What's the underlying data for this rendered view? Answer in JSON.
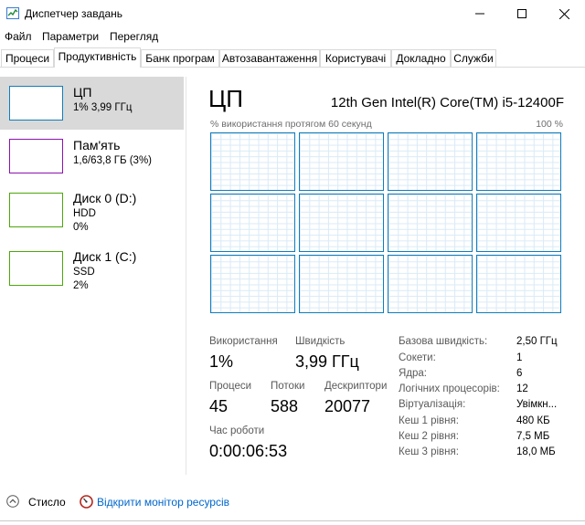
{
  "window": {
    "title": "Диспетчер завдань"
  },
  "menu": [
    "Файл",
    "Параметри",
    "Перегляд"
  ],
  "tabs": [
    "Процеси",
    "Продуктивність",
    "Банк програм",
    "Автозавантаження",
    "Користувачі",
    "Докладно",
    "Служби"
  ],
  "active_tab": "Продуктивність",
  "resources": [
    {
      "name": "ЦП",
      "sub1": "1% 3,99 ГГц",
      "sub2": "",
      "color": "#117dbb",
      "selected": true
    },
    {
      "name": "Пам'ять",
      "sub1": "1,6/63,8 ГБ (3%)",
      "sub2": "",
      "color": "#8b12ae"
    },
    {
      "name": "Диск 0 (D:)",
      "sub1": "HDD",
      "sub2": "0%",
      "color": "#4da60c"
    },
    {
      "name": "Диск 1 (C:)",
      "sub1": "SSD",
      "sub2": "2%",
      "color": "#4da60c"
    }
  ],
  "cpu": {
    "heading": "ЦП",
    "model": "12th Gen Intel(R) Core(TM) i5-12400F",
    "graph_label": "% використання протягом 60 секунд",
    "graph_max": "100 %",
    "utilization_label": "Використання",
    "utilization": "1%",
    "speed_label": "Швидкість",
    "speed": "3,99 ГГц",
    "processes_label": "Процеси",
    "processes": "45",
    "threads_label": "Потоки",
    "threads": "588",
    "handles_label": "Дескриптори",
    "handles": "20077",
    "uptime_label": "Час роботи",
    "uptime": "0:00:06:53"
  },
  "specs": [
    {
      "k": "Базова швидкість:",
      "v": "2,50 ГГц"
    },
    {
      "k": "Сокети:",
      "v": "1"
    },
    {
      "k": "Ядра:",
      "v": "6"
    },
    {
      "k": "Логічних процесорів:",
      "v": "12"
    },
    {
      "k": "Віртуалізація:",
      "v": "Увімкн..."
    },
    {
      "k": "Кеш 1 рівня:",
      "v": "480 КБ"
    },
    {
      "k": "Кеш 2 рівня:",
      "v": "7,5 МБ"
    },
    {
      "k": "Кеш 3 рівня:",
      "v": "18,0 МБ"
    }
  ],
  "footer": {
    "fewer": "Стисло",
    "resmon": "Відкрити монітор ресурсів"
  }
}
